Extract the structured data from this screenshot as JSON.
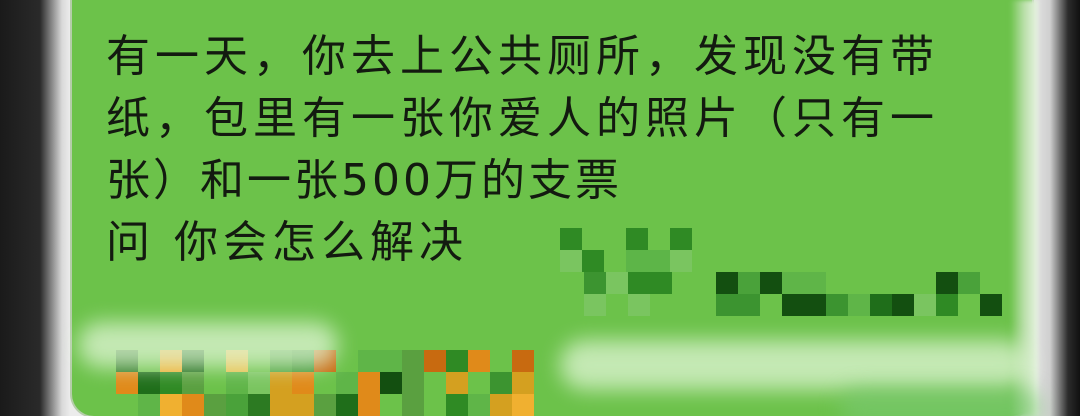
{
  "message": {
    "lines": [
      "有一天，你去上公共厕所，发现没有带",
      "纸，包里有一张你爱人的照片（只有一",
      "张）和一张500万的支票",
      "问 你会怎么解决"
    ]
  },
  "colors": {
    "bubble": "#6cc24a",
    "text": "#131a10",
    "pixelation_dark": "#1f6e1a",
    "pixelation_orange": "#e08a1a"
  }
}
